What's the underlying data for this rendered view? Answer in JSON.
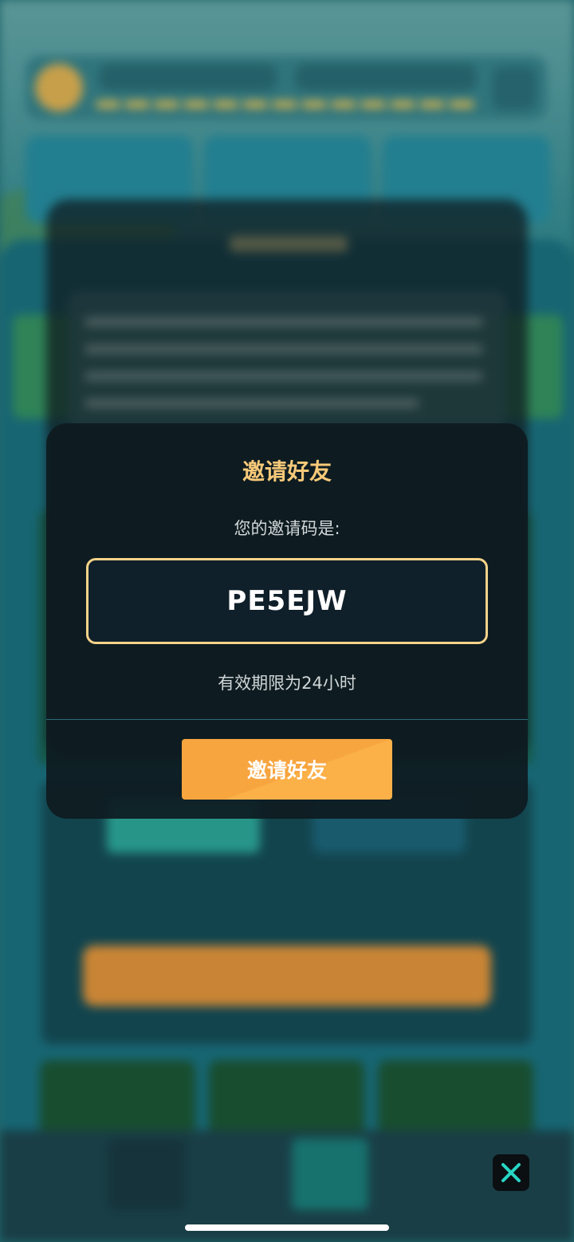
{
  "dialog": {
    "title": "邀请好友",
    "code_label": "您的邀请码是:",
    "invite_code": "PE5EJW",
    "validity_text": "有效期限为24小时",
    "invite_button_label": "邀请好友"
  },
  "overlay": {
    "close_icon": "close-x-icon"
  },
  "colors": {
    "title": "#f7c979",
    "code_border": "#f6d389",
    "button": "#f7a53f",
    "close_icon": "#27d6c4"
  }
}
